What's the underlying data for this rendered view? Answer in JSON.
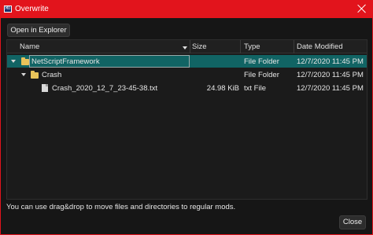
{
  "window": {
    "title": "Overwrite",
    "app_icon_text": "MO"
  },
  "toolbar": {
    "open_explorer_label": "Open in Explorer"
  },
  "columns": [
    "Name",
    "Size",
    "Type",
    "Date Modified"
  ],
  "rows": [
    {
      "name": "NetScriptFramework",
      "size": "",
      "type": "File Folder",
      "date": "12/7/2020 11:45 PM",
      "kind": "folder",
      "expanded": true,
      "selected": true
    },
    {
      "name": "Crash",
      "size": "",
      "type": "File Folder",
      "date": "12/7/2020 11:45 PM",
      "kind": "folder",
      "expanded": true,
      "selected": false
    },
    {
      "name": "Crash_2020_12_7_23-45-38.txt",
      "size": "24.98 KiB",
      "type": "txt File",
      "date": "12/7/2020 11:45 PM",
      "kind": "file",
      "expanded": false,
      "selected": false
    }
  ],
  "status": "You can use drag&drop to move files and directories to regular mods.",
  "footer": {
    "close_label": "Close"
  },
  "colors": {
    "titlebar": "#e2141c",
    "selection": "#116464",
    "folder": "#e8c35a"
  },
  "icons": {
    "close": "close-icon",
    "folder": "folder-icon",
    "file": "file-icon",
    "expand": "chevron-down-icon"
  }
}
